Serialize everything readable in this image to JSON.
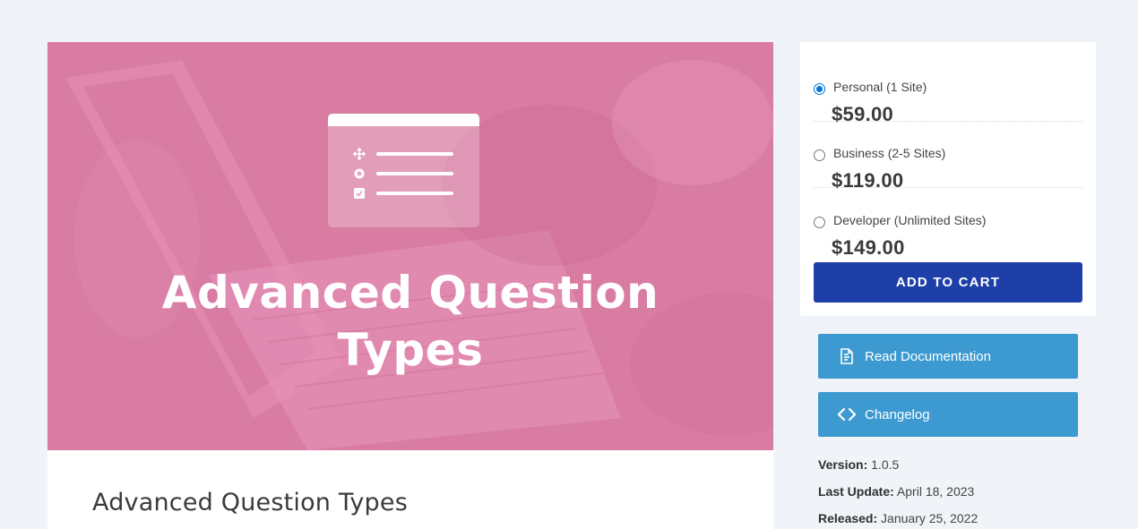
{
  "hero": {
    "title_line1": "Advanced Question",
    "title_line2": "Types",
    "background_color": "#d97ca2"
  },
  "product": {
    "title": "Advanced Question Types"
  },
  "pricing": {
    "options": [
      {
        "label": "Personal (1 Site)",
        "price": "$59.00",
        "selected": true
      },
      {
        "label": "Business (2-5 Sites)",
        "price": "$119.00",
        "selected": false
      },
      {
        "label": "Developer (Unlimited Sites)",
        "price": "$149.00",
        "selected": false
      }
    ],
    "add_to_cart_label": "ADD TO CART",
    "accent_color": "#1e3fa8"
  },
  "links": {
    "documentation_label": "Read Documentation",
    "documentation_icon": "document-icon",
    "changelog_label": "Changelog",
    "changelog_icon": "code-icon",
    "button_color": "#3d9ad1"
  },
  "meta": {
    "version_label": "Version:",
    "version_value": "1.0.5",
    "last_update_label": "Last Update:",
    "last_update_value": "April 18, 2023",
    "released_label": "Released:",
    "released_value": "January 25, 2022"
  }
}
